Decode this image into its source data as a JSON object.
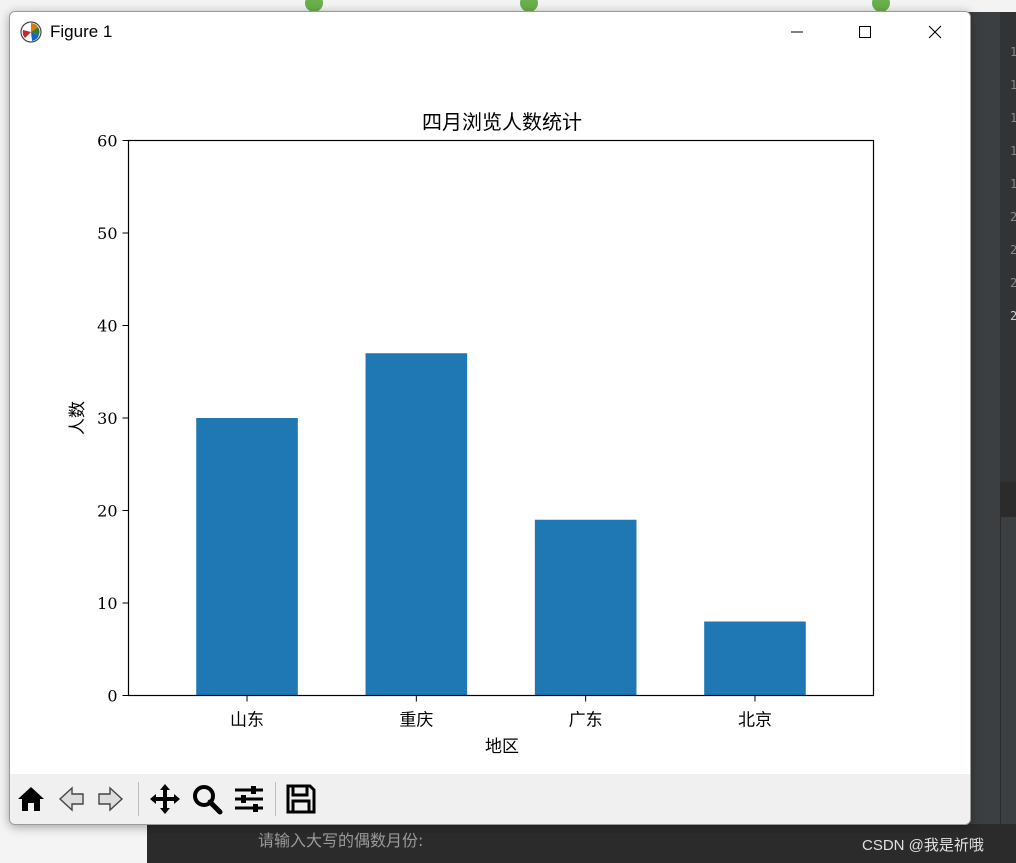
{
  "window": {
    "title": "Figure 1"
  },
  "background": {
    "console_prompt": "请输入大写的偶数月份:",
    "watermark": "CSDN @我是祈哦",
    "line_numbers": [
      "1",
      "1",
      "1",
      "1",
      "1",
      "2",
      "2",
      "2",
      "2"
    ]
  },
  "toolbar": {
    "tools": [
      "home-icon",
      "back-icon",
      "forward-icon",
      "pan-icon",
      "zoom-icon",
      "configure-subplots-icon",
      "save-icon"
    ]
  },
  "chart_data": {
    "type": "bar",
    "title": "四月浏览人数统计",
    "xlabel": "地区",
    "ylabel": "人数",
    "categories": [
      "山东",
      "重庆",
      "广东",
      "北京"
    ],
    "values": [
      30,
      37,
      19,
      8
    ],
    "ylim": [
      0,
      60
    ],
    "yticks": [
      0,
      10,
      20,
      30,
      40,
      50,
      60
    ],
    "bar_color": "#1f77b4",
    "grid": false
  }
}
